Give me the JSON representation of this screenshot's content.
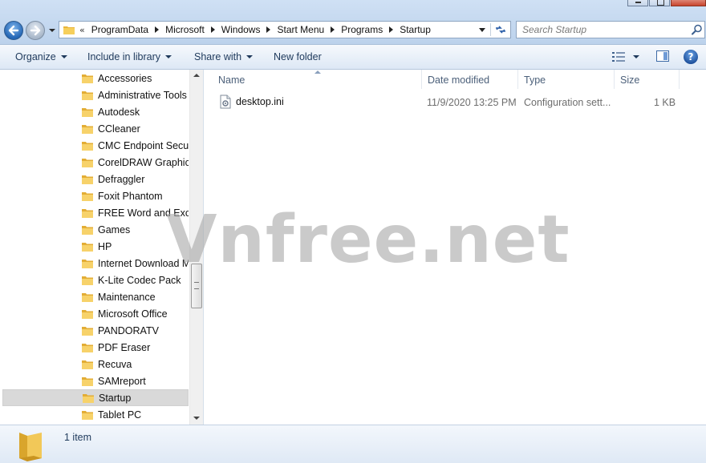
{
  "address": {
    "lead": "«",
    "crumbs": [
      "ProgramData",
      "Microsoft",
      "Windows",
      "Start Menu",
      "Programs",
      "Startup"
    ]
  },
  "search": {
    "placeholder": "Search Startup"
  },
  "toolbar": {
    "organize": "Organize",
    "include_in_library": "Include in library",
    "share_with": "Share with",
    "new_folder": "New folder"
  },
  "help": {
    "label": "?"
  },
  "nav": {
    "items": [
      {
        "label": "Accessories"
      },
      {
        "label": "Administrative Tools"
      },
      {
        "label": "Autodesk"
      },
      {
        "label": "CCleaner"
      },
      {
        "label": "CMC Endpoint Securi"
      },
      {
        "label": "CorelDRAW Graphics"
      },
      {
        "label": "Defraggler"
      },
      {
        "label": "Foxit Phantom"
      },
      {
        "label": "FREE Word and Excel"
      },
      {
        "label": "Games"
      },
      {
        "label": "HP"
      },
      {
        "label": "Internet Download M"
      },
      {
        "label": "K-Lite Codec Pack"
      },
      {
        "label": "Maintenance"
      },
      {
        "label": "Microsoft Office"
      },
      {
        "label": "PANDORATV"
      },
      {
        "label": "PDF Eraser"
      },
      {
        "label": "Recuva"
      },
      {
        "label": "SAMreport"
      },
      {
        "label": "Startup",
        "selected": true
      },
      {
        "label": "Tablet PC"
      }
    ]
  },
  "columns": {
    "name": "Name",
    "date_modified": "Date modified",
    "type": "Type",
    "size": "Size"
  },
  "files": [
    {
      "name": "desktop.ini",
      "date_modified": "11/9/2020 13:25 PM",
      "type": "Configuration sett...",
      "size": "1 KB"
    }
  ],
  "watermark": "Vnfree.net",
  "status": {
    "item_count": "1 item"
  },
  "colors": {
    "command_text": "#1e395b",
    "folder_yellow": "#f4c64e",
    "selected_row": "#d9d9d9"
  }
}
